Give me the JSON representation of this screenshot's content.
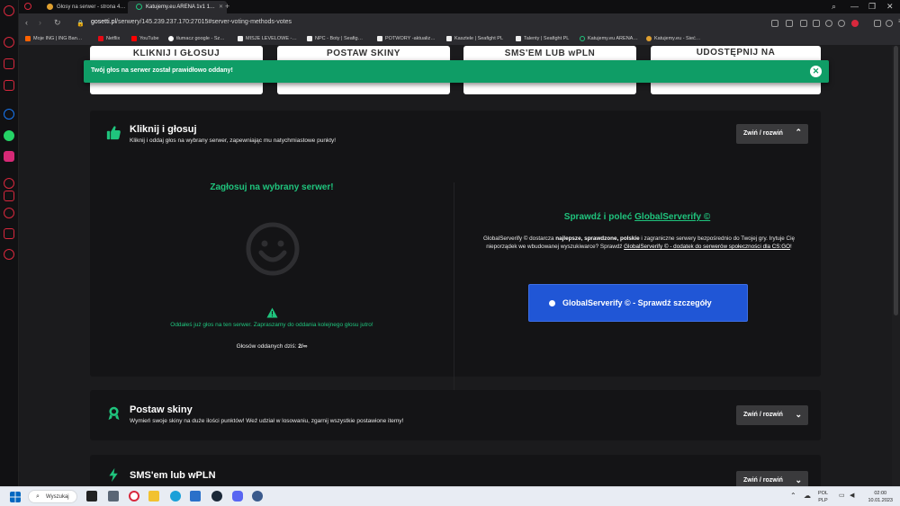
{
  "browser": {
    "tabs": [
      {
        "label": "Głosy na serwer - strona 4…",
        "active": false
      },
      {
        "label": "Katujemy.eu ARENA 1v1 1…",
        "active": true
      }
    ],
    "new_tab": "+",
    "url": {
      "host": "gosetti.pl",
      "path": "/serwery/145.239.237.170:27015#server-voting-methods-votes"
    },
    "bookmarks": [
      "Moje ING | ING Ban…",
      "Netflix",
      "YouTube",
      "tłumacz google - Sz…",
      "MISJE LEVELOWE -…",
      "NPC - Boty | Seafig…",
      "POTWORY -aktualiz…",
      "Kasztele | Seafight PL",
      "Talenty | Seafight PL",
      "Katujemy.eu ARENA…",
      "Katujemy.eu - Sieć…"
    ]
  },
  "top_cards": {
    "card1": "KLIKNIJ I GŁOSUJ",
    "card2": "POSTAW SKINY",
    "card3": "SMS'EM LUB wPLN",
    "card4": "UDOSTĘPNIJ NA"
  },
  "toast": {
    "message": "Twój głos na serwer został prawidłowo oddany!",
    "close_symbol": "✕"
  },
  "section_vote": {
    "title": "Kliknij i głosuj",
    "description": "Kliknij i oddaj głos na wybrany serwer, zapewniając mu natychmiastowe punkty!",
    "toggle_label": "Zwiń / rozwiń",
    "left_title": "Zagłosuj na wybrany serwer!",
    "already_voted": "Oddałeś już głos na ten serwer. Zapraszamy do oddania kolejnego głosu jutro!",
    "votes_today_label": "Głosów oddanych dziś:",
    "votes_today_value": "2/∞",
    "right_title_prefix": "Sprawdź i poleć",
    "right_title_link": "GlobalServerify ©",
    "right_desc_1": "GlobalServerify © dostarcza",
    "right_desc_bold": "najlepsze, sprawdzone, polskie",
    "right_desc_2": "i zagraniczne serwery bezpośrednio do Twojej gry. Irytuje Cię nieporządek we wbudowanej wyszukiwarce? Sprawdź",
    "right_desc_link": "GlobalServerify © - dodatek do serwerów społeczności dla CS:GO",
    "right_desc_end": "!",
    "button_label": "GlobalServerify © - Sprawdź szczegóły"
  },
  "section_skins": {
    "title": "Postaw skiny",
    "description": "Wymień swoje skiny na duże ilości punktów! Weź udział w losowaniu, zgarnij wszystkie postawione itemy!",
    "toggle_label": "Zwiń / rozwiń"
  },
  "section_sms": {
    "title": "SMS'em lub wPLN",
    "toggle_label": "Zwiń / rozwiń"
  },
  "taskbar": {
    "search_label": "Wyszukaj",
    "lang_top": "POL",
    "lang_bottom": "PLP",
    "time": "02:00",
    "date": "10.01.2023"
  },
  "colors": {
    "accent_green": "#1fc47d",
    "toast_green": "#0f9d66",
    "button_blue": "#2056d6",
    "opera_red": "#d8283d"
  }
}
